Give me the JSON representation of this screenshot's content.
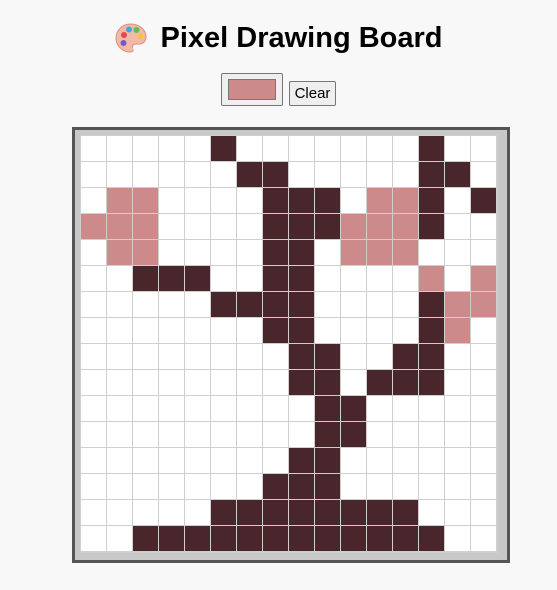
{
  "header": {
    "title": "Pixel Drawing Board",
    "icon": "palette-icon"
  },
  "controls": {
    "color_value": "#cd8a8a",
    "clear_label": "Clear"
  },
  "board": {
    "cols": 16,
    "rows": 16,
    "palette": {
      "0": "#ffffff",
      "1": "#48262c",
      "2": "#cd8a8a"
    },
    "pixels": [
      "0000010000000100",
      "0000001100000110",
      "0220000111022101",
      "2220000111222100",
      "0220000110222000",
      "0011100110000202",
      "0000011110000122",
      "0000000110000120",
      "0000000011001100",
      "0000000011011100",
      "0000000001100000",
      "0000000001100000",
      "0000000011000000",
      "0000000111000000",
      "0000011111111000",
      "0011111111111100"
    ]
  }
}
